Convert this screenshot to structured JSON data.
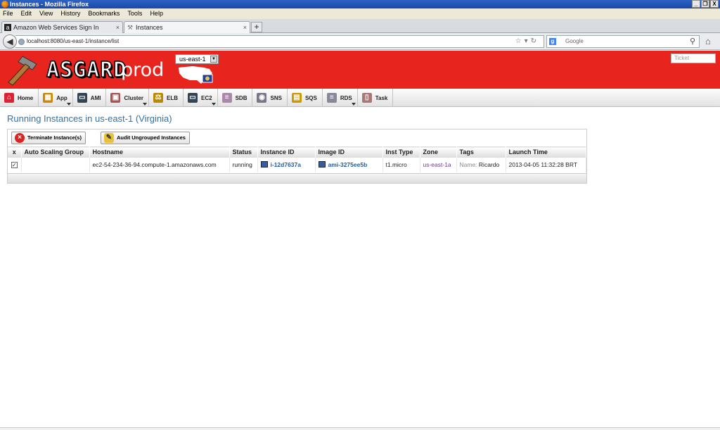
{
  "window": {
    "title": "Instances - Mozilla Firefox",
    "controls": [
      "_",
      "❐",
      "X"
    ]
  },
  "menubar": {
    "items": [
      "File",
      "Edit",
      "View",
      "History",
      "Bookmarks",
      "Tools",
      "Help"
    ]
  },
  "tabs": [
    {
      "label": "Amazon Web Services Sign In",
      "icon": "amazon-icon"
    },
    {
      "label": "Instances",
      "icon": "hammer-icon"
    }
  ],
  "navbar": {
    "url": "localhost:8080/us-east-1/instance/list",
    "search_placeholder": "Google"
  },
  "app": {
    "logo": "ASGARD",
    "env": "prod",
    "region": "us-east-1",
    "ticket_placeholder": "Ticket",
    "nav": [
      {
        "label": "Home",
        "icon": "home-icon",
        "color": "#d23",
        "arrow": false
      },
      {
        "label": "App",
        "icon": "app-icon",
        "color": "#c80",
        "arrow": true
      },
      {
        "label": "AMI",
        "icon": "ami-icon",
        "color": "#345",
        "arrow": false
      },
      {
        "label": "Cluster",
        "icon": "cluster-icon",
        "color": "#a55",
        "arrow": true
      },
      {
        "label": "ELB",
        "icon": "balance-icon",
        "color": "#b80",
        "arrow": false
      },
      {
        "label": "EC2",
        "icon": "monitor-icon",
        "color": "#345",
        "arrow": true
      },
      {
        "label": "SDB",
        "icon": "database-icon",
        "color": "#a8a",
        "arrow": false
      },
      {
        "label": "SNS",
        "icon": "signal-icon",
        "color": "#778",
        "arrow": false
      },
      {
        "label": "SQS",
        "icon": "queue-icon",
        "color": "#c90",
        "arrow": false
      },
      {
        "label": "RDS",
        "icon": "database-icon",
        "color": "#889",
        "arrow": true
      },
      {
        "label": "Task",
        "icon": "clipboard-icon",
        "color": "#a77",
        "arrow": false
      }
    ]
  },
  "page": {
    "title": "Running Instances in us-east-1 (Virginia)",
    "buttons": {
      "terminate": "Terminate Instance(s)",
      "audit": "Audit Ungrouped Instances"
    },
    "columns": [
      "x",
      "Auto Scaling Group",
      "Hostname",
      "Status",
      "Instance ID",
      "Image ID",
      "Inst Type",
      "Zone",
      "Tags",
      "Launch Time"
    ],
    "rows": [
      {
        "checked": "✓",
        "asg": "",
        "hostname": "ec2-54-234-36-94.compute-1.amazonaws.com",
        "status": "running",
        "instance_id": "i-12d7637a",
        "image_id": "ami-3275ee5b",
        "inst_type": "t1.micro",
        "zone": "us-east-1a",
        "tag_key": "Name:",
        "tag_value": "Ricardo",
        "launch_time": "2013-04-05 11:32:28 BRT"
      }
    ]
  }
}
